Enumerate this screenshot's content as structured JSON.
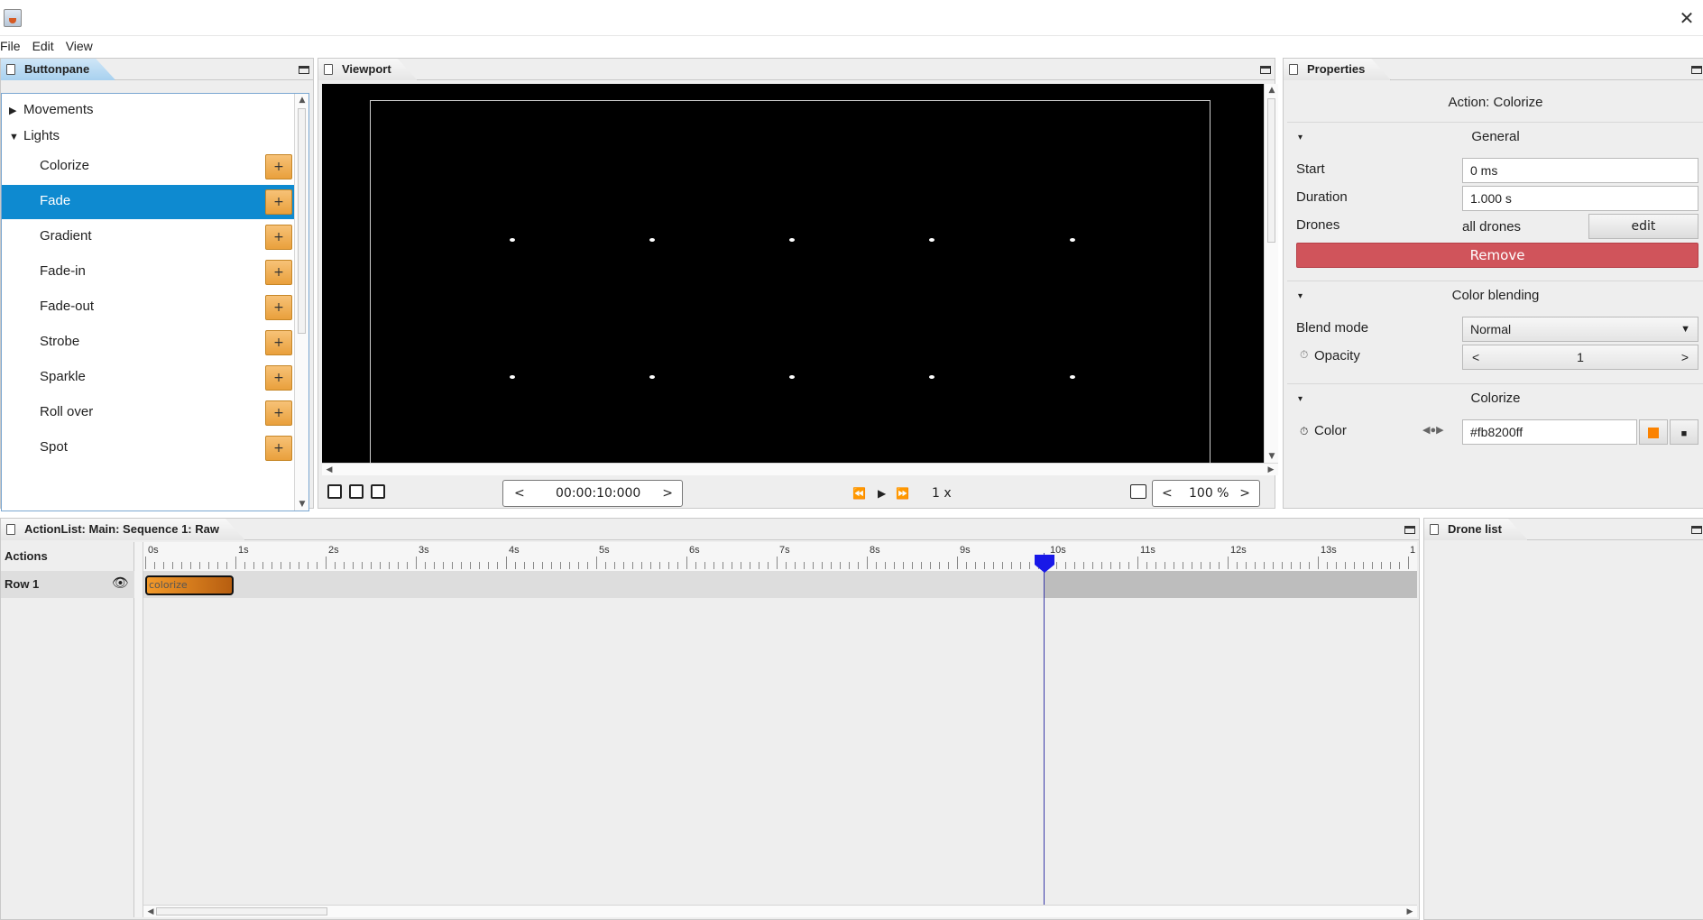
{
  "titlebar": {
    "close_glyph": "✕"
  },
  "menubar": {
    "items": [
      "File",
      "Edit",
      "View"
    ]
  },
  "buttonpane": {
    "title": "Buttonpane",
    "groups": [
      {
        "label": "Movements",
        "expanded": false,
        "arrow": "▶"
      },
      {
        "label": "Lights",
        "expanded": true,
        "arrow": "▼"
      }
    ],
    "items": [
      {
        "label": "Colorize",
        "selected": false
      },
      {
        "label": "Fade",
        "selected": true
      },
      {
        "label": "Gradient",
        "selected": false
      },
      {
        "label": "Fade-in",
        "selected": false
      },
      {
        "label": "Fade-out",
        "selected": false
      },
      {
        "label": "Strobe",
        "selected": false
      },
      {
        "label": "Sparkle",
        "selected": false
      },
      {
        "label": "Roll over",
        "selected": false
      },
      {
        "label": "Spot",
        "selected": false
      }
    ],
    "add_label": "+"
  },
  "viewport": {
    "title": "Viewport",
    "time_prev": "<",
    "time": "00:00:10:000",
    "time_next": ">",
    "rewind": "⏪",
    "play": "▶",
    "forward": "⏩",
    "speed": "1 x",
    "zoom_prev": "<",
    "zoom": "100 %",
    "zoom_next": ">"
  },
  "properties": {
    "title": "Properties",
    "action_title": "Action: Colorize",
    "general": {
      "heading": "General",
      "start_label": "Start",
      "start_value": "0 ms",
      "duration_label": "Duration",
      "duration_value": "1.000 s",
      "drones_label": "Drones",
      "drones_value": "all drones",
      "edit_label": "edit",
      "remove_label": "Remove"
    },
    "blending": {
      "heading": "Color blending",
      "blend_label": "Blend mode",
      "blend_value": "Normal",
      "opacity_label": "Opacity",
      "opacity_value": "1",
      "dec": "<",
      "inc": ">"
    },
    "colorize": {
      "heading": "Colorize",
      "color_label": "Color",
      "color_value": "#fb8200ff",
      "swatch_color": "#fb8200"
    }
  },
  "actionlist": {
    "title": "ActionList: Main: Sequence 1: Raw",
    "actions_header": "Actions",
    "row_label": "Row 1",
    "block_label": "colorize",
    "ticks": [
      "0s",
      "1s",
      "2s",
      "3s",
      "4s",
      "5s",
      "6s",
      "7s",
      "8s",
      "9s",
      "10s",
      "11s",
      "12s",
      "13s",
      "1"
    ]
  },
  "dronelist": {
    "title": "Drone list"
  }
}
